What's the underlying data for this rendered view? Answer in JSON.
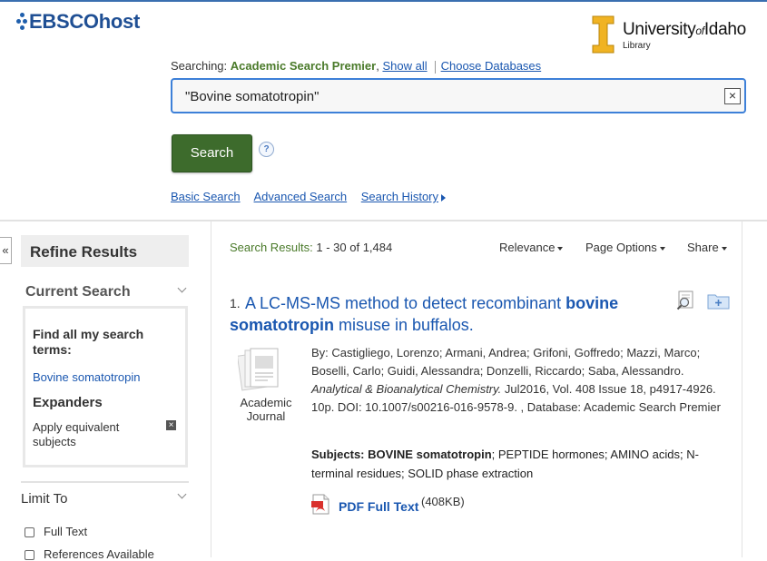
{
  "header": {
    "logo_text": "EBSCOhost",
    "institution": {
      "name_part1": "University",
      "name_of": "of",
      "name_part2": "Idaho",
      "sub": "Library"
    },
    "brand_color": "#1f4f94"
  },
  "search": {
    "searching_label": "Searching:",
    "database": "Academic Search Premier",
    "show_all": "Show all",
    "choose_databases": "Choose Databases",
    "query": "\"Bovine somatotropin\"",
    "search_button": "Search",
    "help": "?",
    "links": [
      "Basic Search",
      "Advanced Search",
      "Search History"
    ]
  },
  "sidebar": {
    "collapse": "«",
    "refine_title": "Refine Results",
    "current_search_title": "Current Search",
    "find_label": "Find all my search terms:",
    "search_term": "Bovine somatotropin",
    "expanders_title": "Expanders",
    "expander_item": "Apply equivalent subjects",
    "limit_title": "Limit To",
    "limits": [
      "Full Text",
      "References Available"
    ]
  },
  "results": {
    "count_label": "Search Results:",
    "count_value": "1 - 30 of 1,484",
    "sort": "Relevance",
    "page_options": "Page Options",
    "share": "Share",
    "items": [
      {
        "number": "1.",
        "title_part1": "A LC-MS-MS method to detect recombinant",
        "title_bold": "bovine somatotropin",
        "title_part2": "misuse in buffalos.",
        "doc_type": "Academic Journal",
        "authors": "By: Castigliego, Lorenzo; Armani, Andrea; Grifoni, Goffredo; Mazzi, Marco; Boselli, Carlo; Guidi, Alessandra; Donzelli, Riccardo; Saba, Alessandro.",
        "journal": "Analytical & Bioanalytical Chemistry.",
        "citation": "Jul2016, Vol. 408 Issue 18, p4917-4926. 10p. DOI: 10.1007/s00216-016-9578-9. , Database: Academic Search Premier",
        "subjects_label": "Subjects:",
        "subjects_bold": "BOVINE somatotropin",
        "subjects_rest": "; PEPTIDE hormones; AMINO acids; N-terminal residues; SOLID phase extraction",
        "pdf_label": "PDF Full Text",
        "pdf_size": "(408KB)"
      }
    ]
  },
  "colors": {
    "link": "#1a57b0",
    "search_button": "#3d6b2c",
    "database_green": "#4a7a2a",
    "search_border": "#3d80d8"
  }
}
